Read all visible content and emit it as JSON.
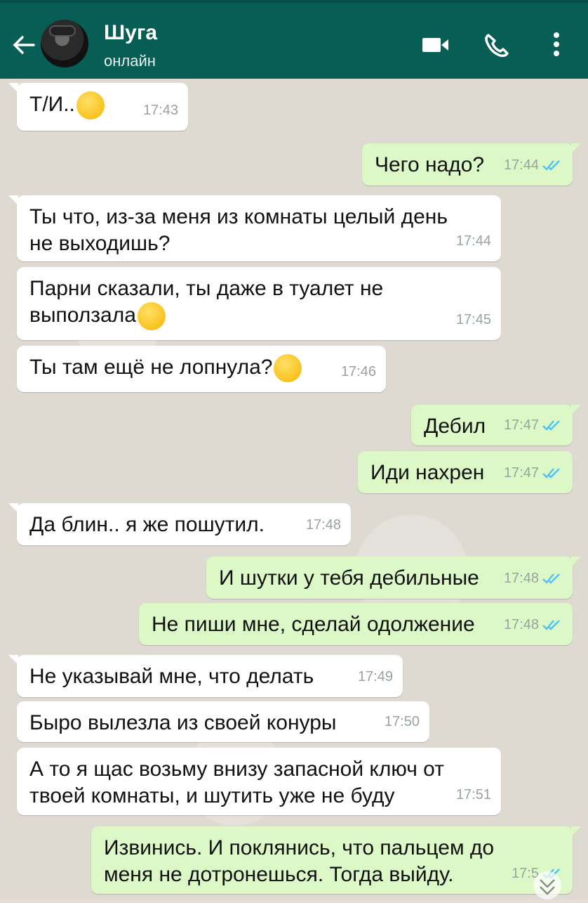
{
  "header": {
    "name": "Шуга",
    "status": "онлайн"
  },
  "colors": {
    "header": "#075e54",
    "incoming_bubble": "#ffffff",
    "outgoing_bubble": "#dcf8c6",
    "read_ticks": "#4fc3f7"
  },
  "icons": {
    "back": "back-arrow-icon",
    "video": "video-call-icon",
    "call": "phone-icon",
    "menu": "more-vert-icon"
  },
  "messages": [
    {
      "dir": "in",
      "text": "Т/И..",
      "emoji": "confused-face",
      "time": "17:43"
    },
    {
      "dir": "out",
      "text": "Чего надо?",
      "time": "17:44",
      "read": true
    },
    {
      "dir": "in",
      "text": "Ты что, из-за меня из комнаты целый день\nне выходишь?",
      "time": "17:44"
    },
    {
      "dir": "in",
      "text": "Парни сказали, ты даже в туалет не\nвыползала",
      "emoji": "astonished-face",
      "time": "17:45"
    },
    {
      "dir": "in",
      "text": "Ты там ещё не лопнула?",
      "emoji": "eye-roll-face",
      "time": "17:46"
    },
    {
      "dir": "out",
      "text": "Дебил",
      "time": "17:47",
      "read": true
    },
    {
      "dir": "out",
      "text": "Иди нахрен",
      "time": "17:47",
      "read": true
    },
    {
      "dir": "in",
      "text": "Да блин.. я же пошутил.",
      "time": "17:48"
    },
    {
      "dir": "out",
      "text": "И шутки у тебя дебильные",
      "time": "17:48",
      "read": true
    },
    {
      "dir": "out",
      "text": "Не пиши мне, сделай одолжение",
      "time": "17:48",
      "read": true
    },
    {
      "dir": "in",
      "text": "Не указывай мне, что делать",
      "time": "17:49"
    },
    {
      "dir": "in",
      "text": "Быро вылезла из своей конуры",
      "time": "17:50"
    },
    {
      "dir": "in",
      "text": "А то я щас возьму внизу запасной ключ от\nтвоей комнаты, и шутить уже не буду",
      "time": "17:51"
    },
    {
      "dir": "out",
      "text": "Извинись. И поклянись, что пальцем до\nменя не дотронешься. Тогда выйду.",
      "time": "17:5",
      "read": true
    }
  ]
}
